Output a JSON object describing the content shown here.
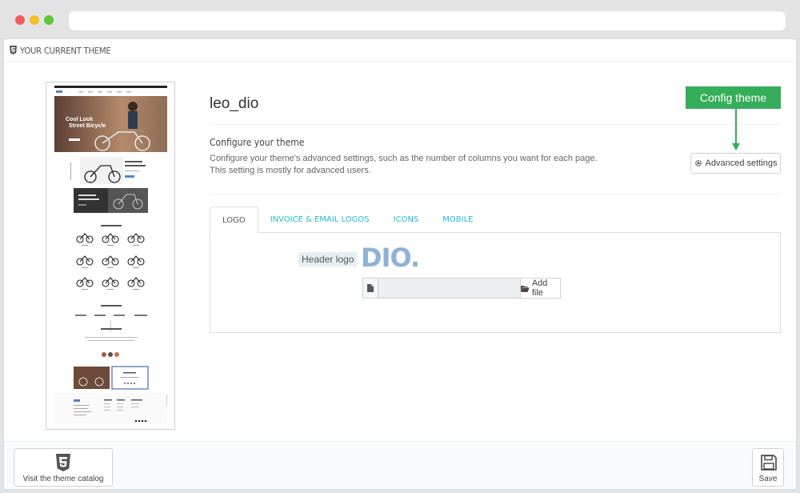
{
  "panel": {
    "title": "YOUR CURRENT THEME"
  },
  "theme": {
    "name": "leo_dio",
    "configure_title": "Configure your theme",
    "configure_desc_1": "Configure your theme's advanced settings, such as the number of columns you want for each page.",
    "configure_desc_2": "This setting is mostly for advanced users.",
    "advanced_label": "Advanced settings",
    "callout": "Config theme"
  },
  "preview": {
    "hero_line1": "Cool Look",
    "hero_line2": "Street Bicycle"
  },
  "tabs": [
    {
      "label": "LOGO",
      "active": true
    },
    {
      "label": "INVOICE & EMAIL LOGOS",
      "active": false
    },
    {
      "label": "ICONS",
      "active": false
    },
    {
      "label": "MOBILE",
      "active": false
    }
  ],
  "logo_tab": {
    "header_logo_label": "Header logo",
    "logo_text": "DIO.",
    "add_file_label": "Add file"
  },
  "footer": {
    "visit_label": "Visit the theme catalog",
    "save_label": "Save"
  },
  "colors": {
    "accent_green": "#35ad5a",
    "link_blue": "#25b9d7",
    "logo_blue": "#8fb1da"
  }
}
